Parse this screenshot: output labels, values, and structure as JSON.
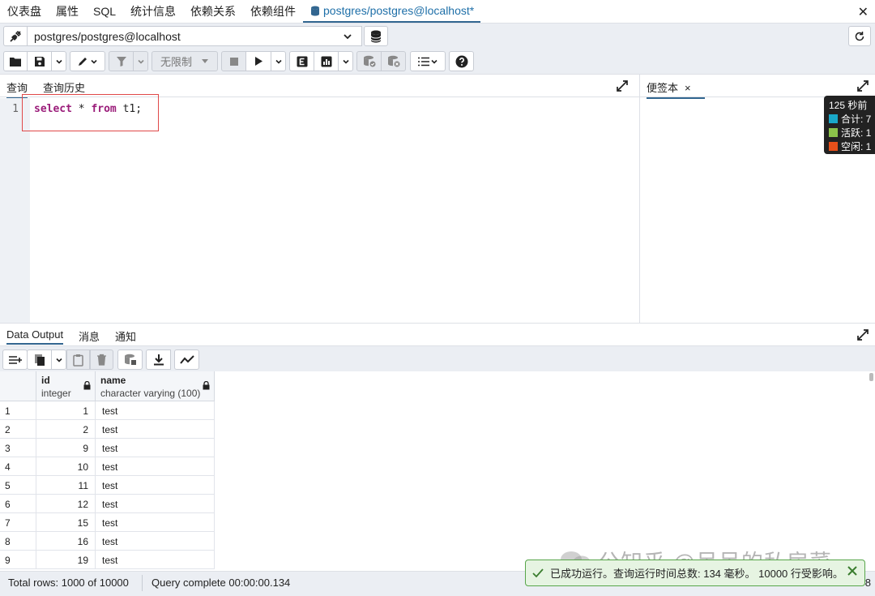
{
  "top_tabs": [
    "仪表盘",
    "属性",
    "SQL",
    "统计信息",
    "依赖关系",
    "依赖组件"
  ],
  "active_tab": "postgres/postgres@localhost*",
  "connection": {
    "label": "postgres/postgres@localhost"
  },
  "toolbar": {
    "limit_label": "无限制"
  },
  "editor_tabs": {
    "query": "查询",
    "history": "查询历史"
  },
  "editor": {
    "line_number": "1",
    "code": {
      "kw1": "select",
      "mid": " * ",
      "kw2": "from",
      "rest": " t1;"
    }
  },
  "notes": {
    "tab_label": "便签本",
    "close": "×"
  },
  "stats": {
    "title": "125 秒前",
    "items": [
      {
        "label": "合计: 7",
        "color": "#19a8c9"
      },
      {
        "label": "活跃: 1",
        "color": "#8bc34a"
      },
      {
        "label": "空闲: 1",
        "color": "#e8501a"
      }
    ]
  },
  "result_tabs": {
    "data": "Data Output",
    "messages": "消息",
    "notices": "通知"
  },
  "grid": {
    "columns": [
      {
        "name": "id",
        "type": "integer"
      },
      {
        "name": "name",
        "type": "character varying (100)"
      }
    ],
    "rows": [
      {
        "rn": "1",
        "id": "1",
        "name": "test"
      },
      {
        "rn": "2",
        "id": "2",
        "name": "test"
      },
      {
        "rn": "3",
        "id": "9",
        "name": "test"
      },
      {
        "rn": "4",
        "id": "10",
        "name": "test"
      },
      {
        "rn": "5",
        "id": "11",
        "name": "test"
      },
      {
        "rn": "6",
        "id": "12",
        "name": "test"
      },
      {
        "rn": "7",
        "id": "15",
        "name": "test"
      },
      {
        "rn": "8",
        "id": "16",
        "name": "test"
      },
      {
        "rn": "9",
        "id": "19",
        "name": "test"
      }
    ]
  },
  "status": {
    "total_rows": "Total rows: 1000 of 10000",
    "query_complete": "Query complete 00:00:00.134",
    "right": "8"
  },
  "toast": {
    "message": "已成功运行。查询运行时间总数: 134 毫秒。 10000 行受影响。"
  },
  "watermark": "公知乎 @呆呆的私房菜"
}
